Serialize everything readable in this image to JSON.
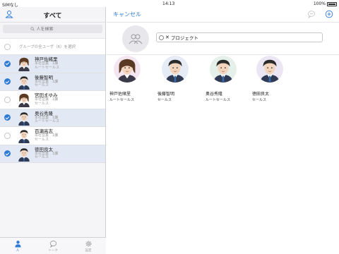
{
  "status": {
    "carrier": "SIMなし",
    "time": "14:13",
    "battery": "100%"
  },
  "left": {
    "title": "すべて",
    "search_placeholder": "人を検索",
    "select_all_label": "グループの全ユーザ（6）を選択",
    "people": [
      {
        "name": "神戸佐緒里",
        "dept": "本社営業　1課",
        "role": "ルートセールス",
        "selected": true,
        "gender": "f"
      },
      {
        "name": "後藤智明",
        "dept": "本社営業　1課",
        "role": "セールス",
        "selected": true,
        "gender": "m"
      },
      {
        "name": "宮田まゆみ",
        "dept": "本社営業　1課",
        "role": "セールス",
        "selected": false,
        "gender": "f"
      },
      {
        "name": "奥谷秀隆",
        "dept": "本社営業　1課",
        "role": "ルートセールス",
        "selected": true,
        "gender": "m"
      },
      {
        "name": "百瀬高志",
        "dept": "本社営業　1課",
        "role": "セールス",
        "selected": false,
        "gender": "m"
      },
      {
        "name": "徳田良太",
        "dept": "本社営業　1課",
        "role": "セールス",
        "selected": true,
        "gender": "m"
      }
    ],
    "tabs": [
      {
        "label": "人",
        "icon": "person-icon",
        "active": true
      },
      {
        "label": "トーク",
        "icon": "chat-icon",
        "active": false
      },
      {
        "label": "設定",
        "icon": "gear-icon",
        "active": false
      }
    ]
  },
  "right": {
    "cancel_label": "キャンセル",
    "group_name_value": "プロジェクト",
    "members": [
      {
        "name": "神戸佐緒里",
        "role": "ルートセールス",
        "bg": "#f4e6f0"
      },
      {
        "name": "後藤智明",
        "role": "セールス",
        "bg": "#e6ecf6"
      },
      {
        "name": "奥谷秀隆",
        "role": "ルートセールス",
        "bg": "#e6f0ea"
      },
      {
        "name": "徳田良太",
        "role": "セールス",
        "bg": "#ece6f4"
      }
    ]
  },
  "colors": {
    "accent": "#2e7bd6",
    "selected_row": "#e3e9f4"
  }
}
